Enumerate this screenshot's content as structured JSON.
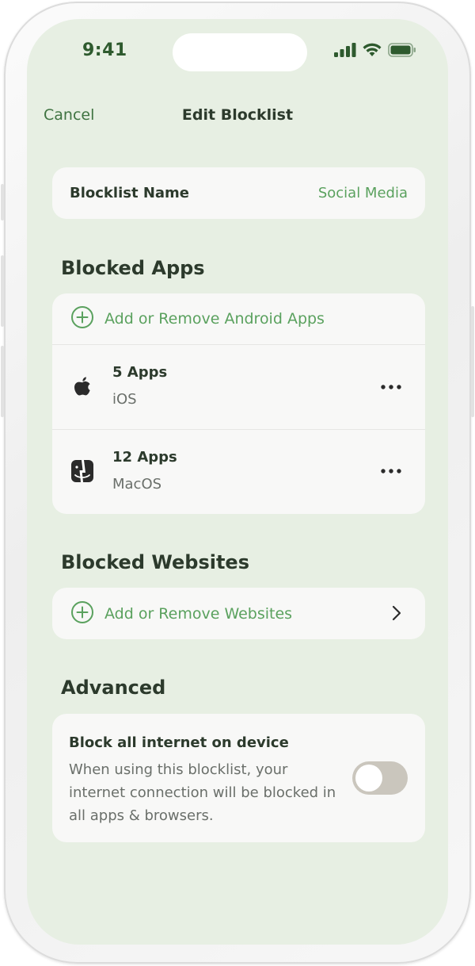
{
  "status_bar": {
    "time": "9:41"
  },
  "nav": {
    "cancel_label": "Cancel",
    "title": "Edit Blocklist"
  },
  "blocklist_name": {
    "label": "Blocklist Name",
    "value": "Social Media"
  },
  "blocked_apps": {
    "title": "Blocked Apps",
    "add_label": "Add or Remove Android Apps",
    "items": [
      {
        "count": "5 Apps",
        "platform": "iOS",
        "icon": "apple-icon"
      },
      {
        "count": "12 Apps",
        "platform": "MacOS",
        "icon": "finder-icon"
      }
    ]
  },
  "blocked_websites": {
    "title": "Blocked Websites",
    "add_label": "Add or Remove Websites"
  },
  "advanced": {
    "title": "Advanced",
    "block_internet_title": "Block all internet on device",
    "block_internet_desc": "When using this blocklist, your internet connection will be blocked in all apps & browsers.",
    "block_internet_enabled": false
  },
  "colors": {
    "background": "#e7efe3",
    "accent": "#5aa15e",
    "nav_accent": "#3f7341",
    "card": "#f8f8f7",
    "text_primary": "#2c3a2c",
    "text_secondary": "#6a6f6a",
    "toggle_off": "#cac6bd"
  }
}
